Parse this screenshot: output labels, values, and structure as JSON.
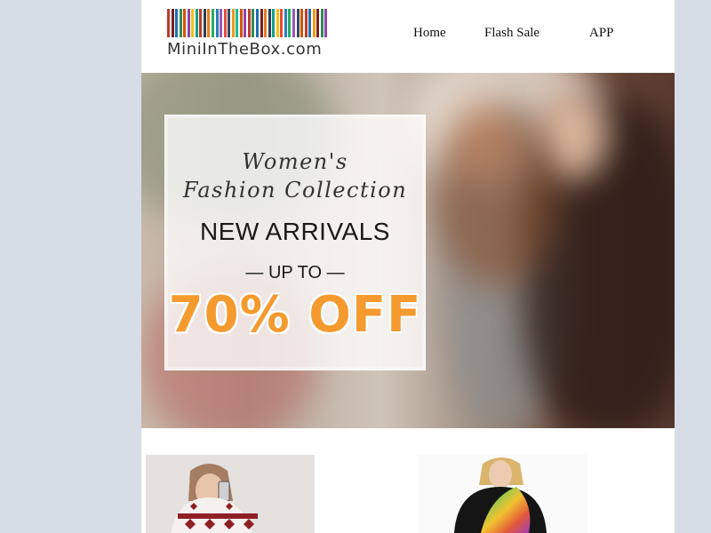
{
  "logo": {
    "text": "MiniInTheBox.com",
    "bar_colors": [
      "#c0392b",
      "#7a1e1e",
      "#1f6fb2",
      "#2e8b57",
      "#d35400",
      "#8e44ad",
      "#f1c40f",
      "#16a085",
      "#c0392b",
      "#2c3e50",
      "#e67e22",
      "#27ae60",
      "#2980b9",
      "#9b59b6",
      "#e74c3c",
      "#34495e",
      "#f39c12",
      "#1abc9c",
      "#d35400",
      "#8e44ad",
      "#c0392b",
      "#2e8b57",
      "#1f6fb2",
      "#7a1e1e",
      "#e67e22",
      "#2c3e50",
      "#16a085",
      "#f1c40f",
      "#e74c3c",
      "#2980b9",
      "#27ae60",
      "#9b59b6",
      "#34495e",
      "#d35400",
      "#c0392b",
      "#1f6fb2",
      "#f39c12",
      "#7a1e1e",
      "#2e8b57",
      "#8e44ad"
    ]
  },
  "nav": {
    "home": "Home",
    "flash_sale": "Flash Sale",
    "app": "APP"
  },
  "hero": {
    "script_line1": "Women's",
    "script_line2": "Fashion Collection",
    "headline": "NEW ARRIVALS",
    "up_to": "— UP TO —",
    "discount": "70% OFF",
    "accent_color": "#f59a2e"
  },
  "products": [
    {
      "name": "product-white-reindeer-sweater"
    },
    {
      "name": "product-black-rainbow-top"
    },
    {
      "name": "product-partial"
    }
  ]
}
